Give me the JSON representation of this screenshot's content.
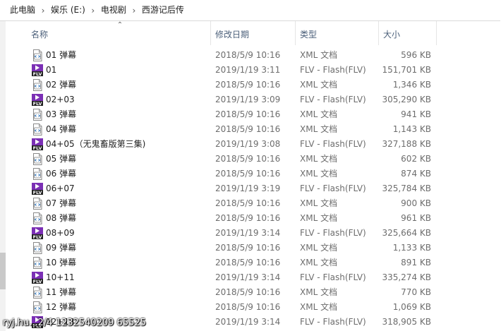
{
  "breadcrumb": [
    "此电脑",
    "娱乐 (E:)",
    "电视剧",
    "西游记后传"
  ],
  "columns": {
    "name": "名称",
    "date": "修改日期",
    "type": "类型",
    "size": "大小"
  },
  "files": [
    {
      "name": "01 弹幕",
      "date": "2018/5/9 10:16",
      "type": "XML 文档",
      "size": "596 KB",
      "icon": "xml-file-icon"
    },
    {
      "name": "01",
      "date": "2019/1/19 3:11",
      "type": "FLV - Flash(FLV)",
      "size": "151,701 KB",
      "icon": "flv-file-icon"
    },
    {
      "name": "02 弹幕",
      "date": "2018/5/9 10:16",
      "type": "XML 文档",
      "size": "1,346 KB",
      "icon": "xml-file-icon"
    },
    {
      "name": "02+03",
      "date": "2019/1/19 3:09",
      "type": "FLV - Flash(FLV)",
      "size": "305,290 KB",
      "icon": "flv-file-icon"
    },
    {
      "name": "03 弹幕",
      "date": "2018/5/9 10:16",
      "type": "XML 文档",
      "size": "941 KB",
      "icon": "xml-file-icon"
    },
    {
      "name": "04 弹幕",
      "date": "2018/5/9 10:16",
      "type": "XML 文档",
      "size": "1,143 KB",
      "icon": "xml-file-icon"
    },
    {
      "name": "04+05（无鬼畜版第三集)",
      "date": "2019/1/19 3:08",
      "type": "FLV - Flash(FLV)",
      "size": "327,188 KB",
      "icon": "flv-file-icon"
    },
    {
      "name": "05 弹幕",
      "date": "2018/5/9 10:16",
      "type": "XML 文档",
      "size": "602 KB",
      "icon": "xml-file-icon"
    },
    {
      "name": "06 弹幕",
      "date": "2018/5/9 10:16",
      "type": "XML 文档",
      "size": "874 KB",
      "icon": "xml-file-icon"
    },
    {
      "name": "06+07",
      "date": "2019/1/19 3:19",
      "type": "FLV - Flash(FLV)",
      "size": "325,784 KB",
      "icon": "flv-file-icon"
    },
    {
      "name": "07 弹幕",
      "date": "2018/5/9 10:16",
      "type": "XML 文档",
      "size": "900 KB",
      "icon": "xml-file-icon"
    },
    {
      "name": "08 弹幕",
      "date": "2018/5/9 10:16",
      "type": "XML 文档",
      "size": "961 KB",
      "icon": "xml-file-icon"
    },
    {
      "name": "08+09",
      "date": "2019/1/19 3:14",
      "type": "FLV - Flash(FLV)",
      "size": "325,664 KB",
      "icon": "flv-file-icon"
    },
    {
      "name": "09 弹幕",
      "date": "2018/5/9 10:16",
      "type": "XML 文档",
      "size": "1,133 KB",
      "icon": "xml-file-icon"
    },
    {
      "name": "10 弹幕",
      "date": "2018/5/9 10:16",
      "type": "XML 文档",
      "size": "891 KB",
      "icon": "xml-file-icon"
    },
    {
      "name": "10+11",
      "date": "2019/1/19 3:14",
      "type": "FLV - Flash(FLV)",
      "size": "335,274 KB",
      "icon": "flv-file-icon"
    },
    {
      "name": "11 弹幕",
      "date": "2018/5/9 10:16",
      "type": "XML 文档",
      "size": "770 KB",
      "icon": "xml-file-icon"
    },
    {
      "name": "12 弹幕",
      "date": "2018/5/9 10:16",
      "type": "XML 文档",
      "size": "1,069 KB",
      "icon": "xml-file-icon"
    },
    {
      "name": "12+13",
      "date": "2019/1/19 3:14",
      "type": "FLV - Flash(FLV)",
      "size": "318,905 KB",
      "icon": "flv-file-icon"
    }
  ],
  "watermark": "ryj.hu...2/4 1232540209 65525",
  "colors": {
    "flv_icon": "#7b2fb5",
    "header_text": "#4c607a",
    "meta_text": "#6d6d6d"
  }
}
